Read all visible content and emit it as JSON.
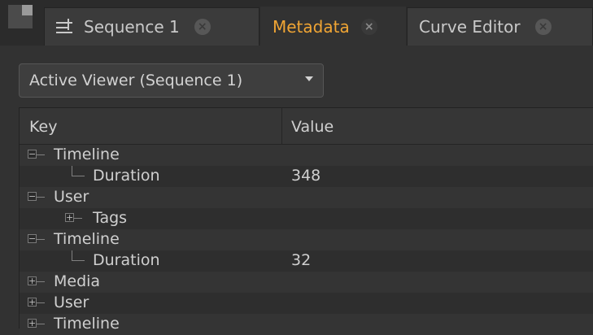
{
  "tabs": [
    {
      "label": "Sequence 1",
      "icon": "sequence-icon",
      "active": false
    },
    {
      "label": "Metadata",
      "icon": "",
      "active": true
    },
    {
      "label": "Curve Editor",
      "icon": "",
      "active": false
    }
  ],
  "viewer_select": {
    "value": "Active Viewer (Sequence 1)"
  },
  "table": {
    "headers": {
      "key": "Key",
      "value": "Value"
    },
    "rows": [
      {
        "key": "Timeline",
        "value": "",
        "depth": 0,
        "expander": "collapse"
      },
      {
        "key": "Duration",
        "value": "348",
        "depth": 1,
        "expander": "none"
      },
      {
        "key": "User",
        "value": "",
        "depth": 0,
        "expander": "collapse"
      },
      {
        "key": "Tags",
        "value": "",
        "depth": 1,
        "expander": "expand"
      },
      {
        "key": "Timeline",
        "value": "",
        "depth": 0,
        "expander": "collapse"
      },
      {
        "key": "Duration",
        "value": "32",
        "depth": 1,
        "expander": "none"
      },
      {
        "key": "Media",
        "value": "",
        "depth": 0,
        "expander": "expand"
      },
      {
        "key": "User",
        "value": "",
        "depth": 0,
        "expander": "expand"
      },
      {
        "key": "Timeline",
        "value": "",
        "depth": 0,
        "expander": "expand"
      }
    ]
  },
  "colors": {
    "active_tab_text": "#f0a534",
    "background": "#323232"
  }
}
